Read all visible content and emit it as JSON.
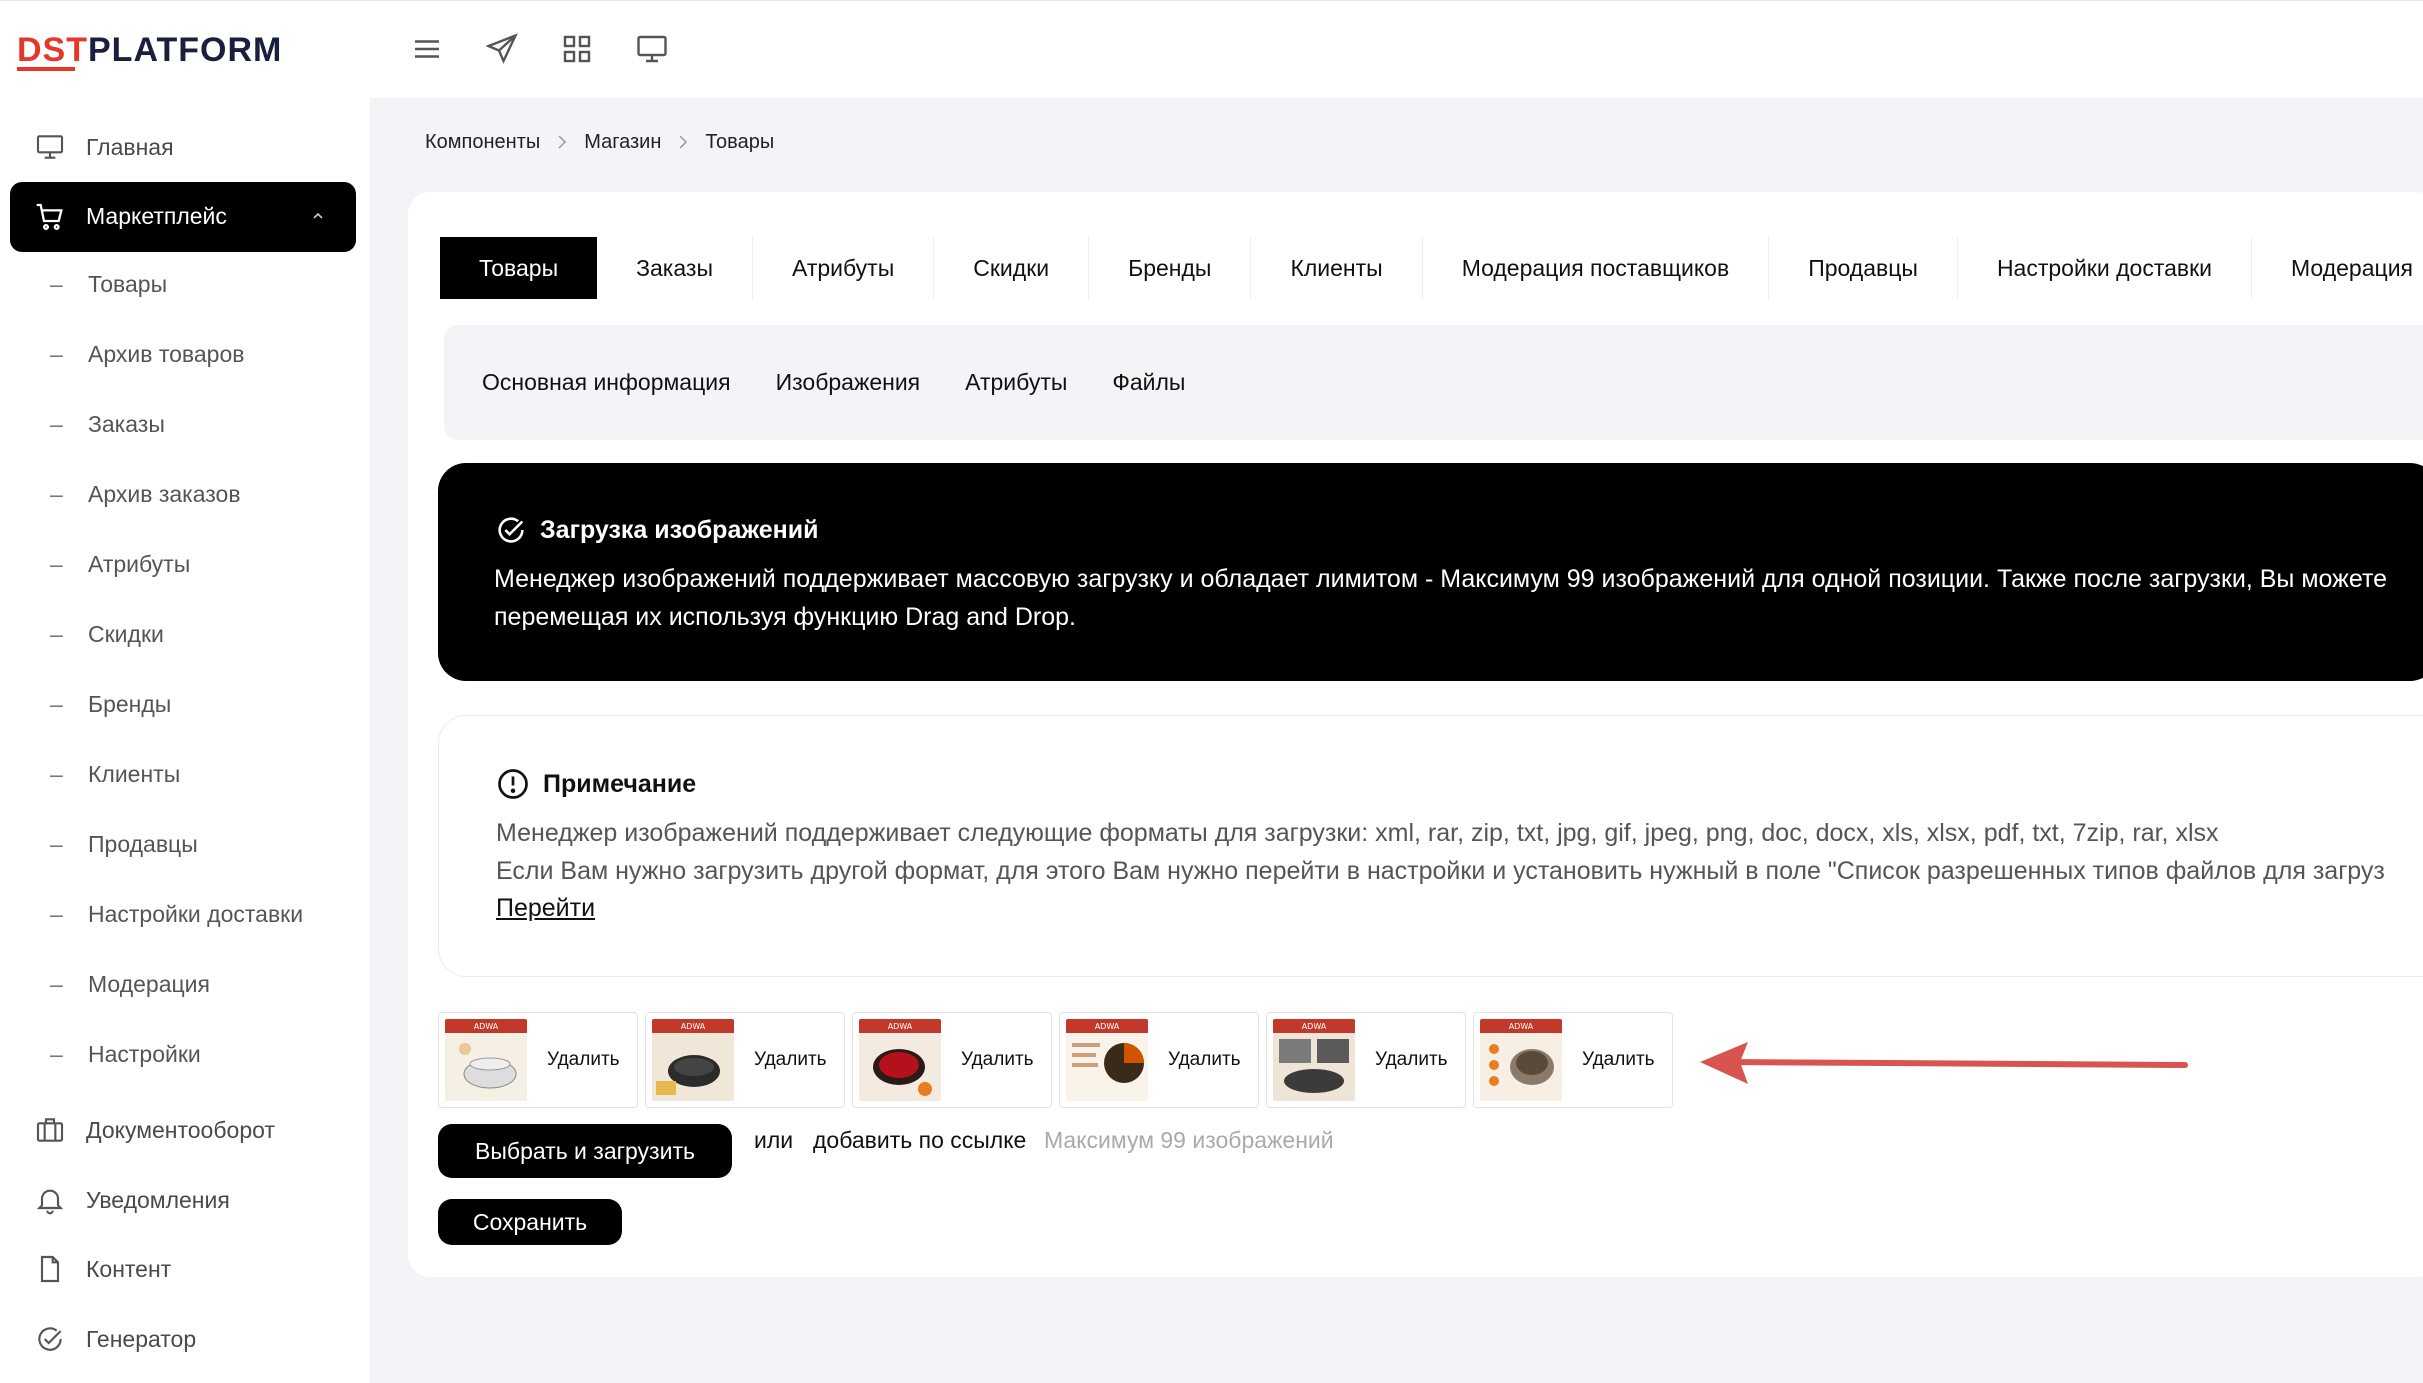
{
  "app": {
    "logo_dst": "DST",
    "logo_platform": "PLATFORM"
  },
  "topbar": {
    "icons": [
      "menu-icon",
      "send-icon",
      "grid-icon",
      "monitor-icon"
    ]
  },
  "sidebar": {
    "home": "Главная",
    "marketplace": "Маркетплейс",
    "sub": [
      "Товары",
      "Архив товаров",
      "Заказы",
      "Архив заказов",
      "Атрибуты",
      "Скидки",
      "Бренды",
      "Клиенты",
      "Продавцы",
      "Настройки доставки",
      "Модерация",
      "Настройки"
    ],
    "docs": "Документооборот",
    "notifications": "Уведомления",
    "content": "Контент",
    "generator": "Генератор"
  },
  "breadcrumb": [
    "Компоненты",
    "Магазин",
    "Товары"
  ],
  "tabs": [
    "Товары",
    "Заказы",
    "Атрибуты",
    "Скидки",
    "Бренды",
    "Клиенты",
    "Модерация поставщиков",
    "Продавцы",
    "Настройки доставки",
    "Модерация"
  ],
  "subtabs": [
    "Основная информация",
    "Изображения",
    "Атрибуты",
    "Файлы"
  ],
  "upload_info": {
    "title": "Загрузка изображений",
    "line1": "Менеджер изображений поддерживает массовую загрузку и обладает лимитом - Максимум 99 изображений для одной позиции. Также после загрузки, Вы можете",
    "line2": "перемещая их используя функцию Drag and Drop."
  },
  "note": {
    "title": "Примечание",
    "line1": "Менеджер изображений поддерживает следующие форматы для загрузки: xml, rar, zip, txt, jpg, gif, jpeg, png, doc, docx, xls, xlsx, pdf, txt, 7zip, rar, xlsx",
    "line2": "Если Вам нужно загрузить другой формат, для этого Вам нужно перейти в настройки и установить нужный в поле \"Список разрешенных типов файлов для загруз",
    "link": "Перейти"
  },
  "thumbs": [
    {
      "delete": "Удалить",
      "brand": "ADWA",
      "color": "#c0392b"
    },
    {
      "delete": "Удалить",
      "brand": "ADWA",
      "color": "#2b2b2b"
    },
    {
      "delete": "Удалить",
      "brand": "ADWA",
      "color": "#b3121d"
    },
    {
      "delete": "Удалить",
      "brand": "ADWA",
      "color": "#d35400"
    },
    {
      "delete": "Удалить",
      "brand": "ADWA",
      "color": "#3b3b3b"
    },
    {
      "delete": "Удалить",
      "brand": "ADWA",
      "color": "#e67e22"
    }
  ],
  "actions": {
    "upload": "Выбрать и загрузить",
    "or": "или",
    "add_link": "добавить по ссылке",
    "max": "Максимум 99 изображений",
    "save": "Сохранить"
  },
  "colors": {
    "accent": "#e5372a",
    "arrow": "#d9534f",
    "active": "#000000"
  }
}
